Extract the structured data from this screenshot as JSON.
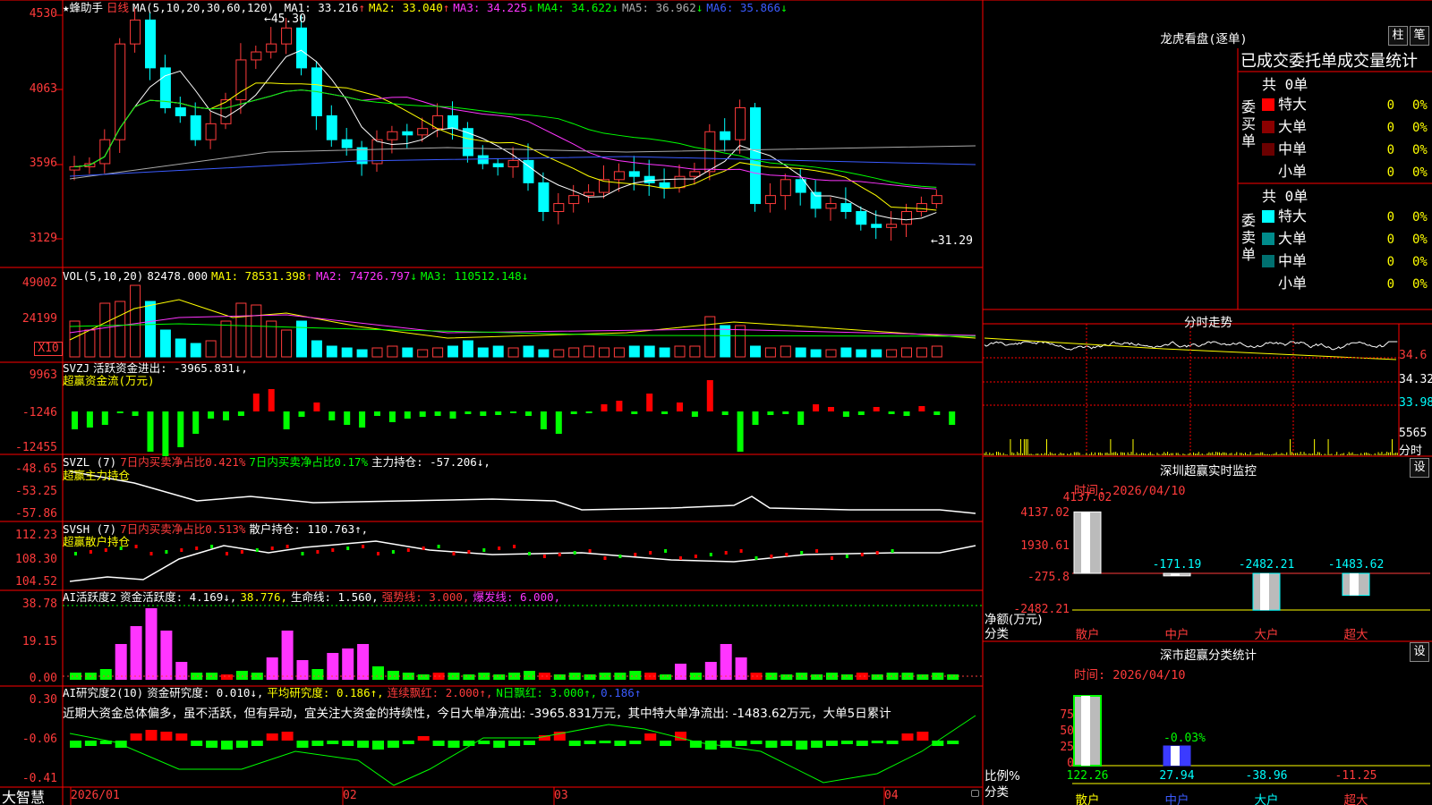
{
  "app": {
    "brand": "大智慧",
    "helper": "★蜂助手",
    "period": "日线"
  },
  "colors": {
    "up": "#ff3b3b",
    "down": "#00ffff",
    "grid": "#ff0000",
    "bg": "#000000"
  },
  "price": {
    "ma_header": "MA(5,10,20,30,60,120)",
    "ma_items": [
      {
        "label": "MA1: 33.216",
        "arrow": "↑",
        "color": "#ffffff"
      },
      {
        "label": "MA2: 33.040",
        "arrow": "↑",
        "color": "#ffff00"
      },
      {
        "label": "MA3: 34.225",
        "arrow": "↓",
        "color": "#ff35ff"
      },
      {
        "label": "MA4: 34.622",
        "arrow": "↓",
        "color": "#00ff00"
      },
      {
        "label": "MA5: 36.962",
        "arrow": "↓",
        "color": "#aaaaaa"
      },
      {
        "label": "MA6: 35.866",
        "arrow": "↓",
        "color": "#3b5bff"
      }
    ],
    "y_ticks": [
      "4530",
      "4063",
      "3596",
      "3129"
    ],
    "high_marker": "45.30",
    "low_marker": "31.29"
  },
  "volume": {
    "header": "VOL(5,10,20)",
    "value": "82478.000",
    "ma_items": [
      {
        "label": "MA1: 78531.398",
        "arrow": "↑",
        "color": "#ffff00"
      },
      {
        "label": "MA2: 74726.797",
        "arrow": "↓",
        "color": "#ff35ff"
      },
      {
        "label": "MA3: 110512.148",
        "arrow": "↓",
        "color": "#00ff00"
      }
    ],
    "y_ticks": [
      "49002",
      "24199"
    ],
    "unit": "X10"
  },
  "svzj": {
    "header": "SVZJ",
    "label": "活跃资金进出: -3965.831↓,",
    "sub": "超赢资金流(万元)",
    "y_ticks": [
      "9963",
      "-1246",
      "-12455"
    ]
  },
  "svzl": {
    "header": "SVZL (7)",
    "a": "7日内买卖净占比0.421%",
    "b": "7日内买卖净占比0.17%",
    "c": "主力持仓: -57.206↓,",
    "sub": "超赢主力持仓",
    "y_ticks": [
      "-48.65",
      "-53.25",
      "-57.86"
    ]
  },
  "svsh": {
    "header": "SVSH (7)",
    "a": "7日内买卖净占比0.513%",
    "c": "散户持仓: 110.763↑,",
    "sub": "超赢散户持仓",
    "y_ticks": [
      "112.23",
      "108.30",
      "104.52"
    ]
  },
  "ai1": {
    "header": "AI活跃度2",
    "a": "资金活跃度: 4.169↓,",
    "b": "38.776,",
    "c": "生命线: 1.560,",
    "d": "强势线: 3.000,",
    "e": "爆发线: 6.000,",
    "y_ticks": [
      "38.78",
      "19.15",
      "0.00"
    ]
  },
  "ai2": {
    "header": "AI研究度2(10)",
    "a": "资金研究度: 0.010↓,",
    "b": "平均研究度: 0.186↑,",
    "c": "连续飘红: 2.000↑,",
    "d": "N日飘红: 3.000↑,",
    "e": "0.186↑",
    "comment": "近期大资金总体偏多，虽不活跃，但有异动，宜关注大资金的持续性，今日大单净流出: -3965.831万元，其中特大单净流出: -1483.62万元，大单5日累计",
    "y_ticks": [
      "0.30",
      "-0.06",
      "-0.41"
    ]
  },
  "xaxis": [
    "2026/01",
    "02",
    "03",
    "04"
  ],
  "longhu": {
    "title": "龙虎看盘(逐单)",
    "btn1": "柱",
    "btn2": "笔",
    "header": "已成交委托单成交量统计",
    "buy_title": "委买单",
    "sell_title": "委卖单",
    "buy_total": "共 0单",
    "sell_total": "共 0单",
    "buy": [
      {
        "name": "特大",
        "count": "0",
        "pct": "0%",
        "color": "#ff0000"
      },
      {
        "name": "大单",
        "count": "0",
        "pct": "0%",
        "color": "#8b0000"
      },
      {
        "name": "中单",
        "count": "0",
        "pct": "0%",
        "color": "#6b0000"
      },
      {
        "name": "小单",
        "count": "0",
        "pct": "0%",
        "color": "#000000"
      }
    ],
    "sell": [
      {
        "name": "特大",
        "count": "0",
        "pct": "0%",
        "color": "#00ffff"
      },
      {
        "name": "大单",
        "count": "0",
        "pct": "0%",
        "color": "#008b8b"
      },
      {
        "name": "中单",
        "count": "0",
        "pct": "0%",
        "color": "#007070"
      },
      {
        "name": "小单",
        "count": "0",
        "pct": "0%",
        "color": "#000000"
      }
    ]
  },
  "intraday": {
    "title": "分时走势",
    "p1": "34.6",
    "p2": "34.32",
    "p3": "33.98",
    "vol": "5565",
    "vol_label": "分时"
  },
  "monitor": {
    "title": "深圳超赢实时监控",
    "setting": "设",
    "time_label": "时间: 2026/04/10",
    "y_ticks": [
      "4137.02",
      "1930.61",
      "-275.8",
      "-2482.21"
    ],
    "y_unit": "净额(万元)",
    "cat_label": "分类",
    "bars": [
      {
        "name": "散户",
        "value": "4137.02"
      },
      {
        "name": "中户",
        "value": "-171.19"
      },
      {
        "name": "大户",
        "value": "-2482.21"
      },
      {
        "name": "超大",
        "value": "-1483.62"
      }
    ]
  },
  "classify": {
    "title": "深市超赢分类统计",
    "setting": "设",
    "time_label": "时间: 2026/04/10",
    "y_ticks": [
      "75",
      "50",
      "25",
      "0"
    ],
    "y_unit": "比例%",
    "cat_label": "分类",
    "extra": "-0.03%",
    "bars": [
      {
        "name": "散户",
        "value": "122.26"
      },
      {
        "name": "中户",
        "value": "27.94"
      },
      {
        "name": "大户",
        "value": "-38.96"
      },
      {
        "name": "超大",
        "value": "-11.25"
      }
    ]
  }
}
